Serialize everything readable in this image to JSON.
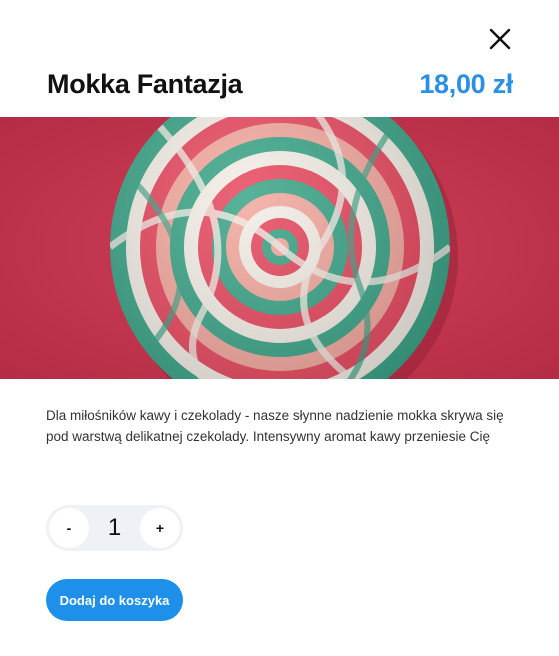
{
  "product": {
    "title": "Mokka Fantazja",
    "price": "18,00 zł",
    "image_icon": "lollipop-image",
    "description": "Dla miłośników kawy i czekolady - nasze słynne nadzienie mokka skrywa się pod warstwą delikatnej czekolady. Intensywny aromat kawy przeniesie Cię"
  },
  "quantity": {
    "decrement_label": "-",
    "value": "1",
    "increment_label": "+"
  },
  "actions": {
    "add_to_cart_label": "Dodaj do koszyka",
    "close_icon": "close-icon"
  },
  "colors": {
    "accent": "#1e90ea",
    "price": "#2b8fe6",
    "image_background": "#c5374f"
  }
}
